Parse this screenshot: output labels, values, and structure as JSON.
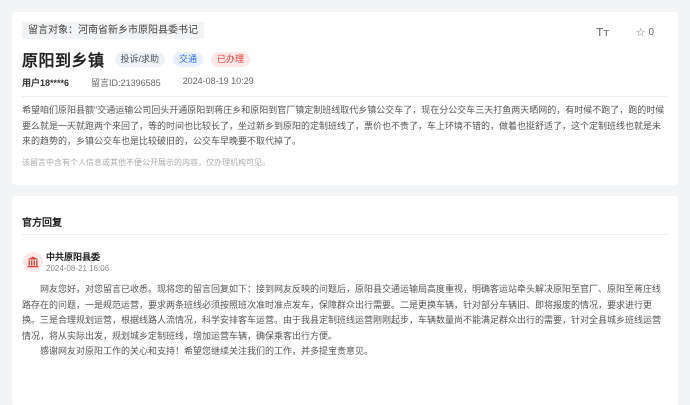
{
  "message": {
    "target_label": "留言对象：",
    "target_value": "河南省新乡市原阳县委书记",
    "title": "原阳到乡镇",
    "tags": {
      "type": "投诉/求助",
      "field": "交通",
      "status": "已办理"
    },
    "user_label": "用户",
    "user_id": "18****6",
    "message_id_label": "留言ID:",
    "message_id": "21396585",
    "date": "2024-08-19 10:29",
    "content": "希望咱们原阳县额\"交通运输公司回头开通原阳到蒋庄乡和原阳到官厂镇定制班线取代乡镇公交车了，现在分公交车三天打鱼两天晒网的，有时候不跑了，跑的时候要么就是一天就跑两个来回了，等的时间也比较长了，坐过新乡到原阳的定制班线了，票价也不贵了，车上环境不错的，做着也挺舒适了，这个定制班线也就是未来的趋势的，乡镇公交车也是比较破旧的，公交车早晚要不取代掉了。",
    "tip": "该留言中含有个人信息或其他不便公开展示的内容，仅办理机构可见。"
  },
  "toolbar": {
    "font_icon": "Tт",
    "star_icon": "☆",
    "favorite_count": "0"
  },
  "reply": {
    "heading": "官方回复",
    "org_name": "中共原阳县委",
    "time": "2024-08-21 16:06",
    "paragraphs": [
      "网友您好，对您留言已收悉。现将您的留言回复如下：接到网友反映的问题后，原阳县交通运输局高度重视，明确客运站牵头解决原阳至官厂、原阳至蒋庄线路存在的问题，一是规范运营，要求两条班线必须按照班次准时准点发车，保障群众出行需要。二是更换车辆，针对部分车辆旧、即将报废的情况，要求进行更换。三是合理规划运营，根据线路人流情况，科学安排客车运营。由于我县定制班线运营刚刚起步，车辆数量尚不能满足群众出行的需要，针对全县城乡班线运营情况，将从实际出发，规划城乡定制班线，增加运营车辆，确保乘客出行方便。",
      "感谢网友对原阳工作的关心和支持！希望您继续关注我们的工作，并多提宝贵意见。"
    ]
  },
  "colors": {
    "status_red": "#e03b3b",
    "accent_blue": "#2f6fe0",
    "logo_red": "#d9453a"
  },
  "icons": {
    "font_size": "font-size-icon",
    "favorite": "star-icon",
    "org_logo": "government-building-icon"
  }
}
